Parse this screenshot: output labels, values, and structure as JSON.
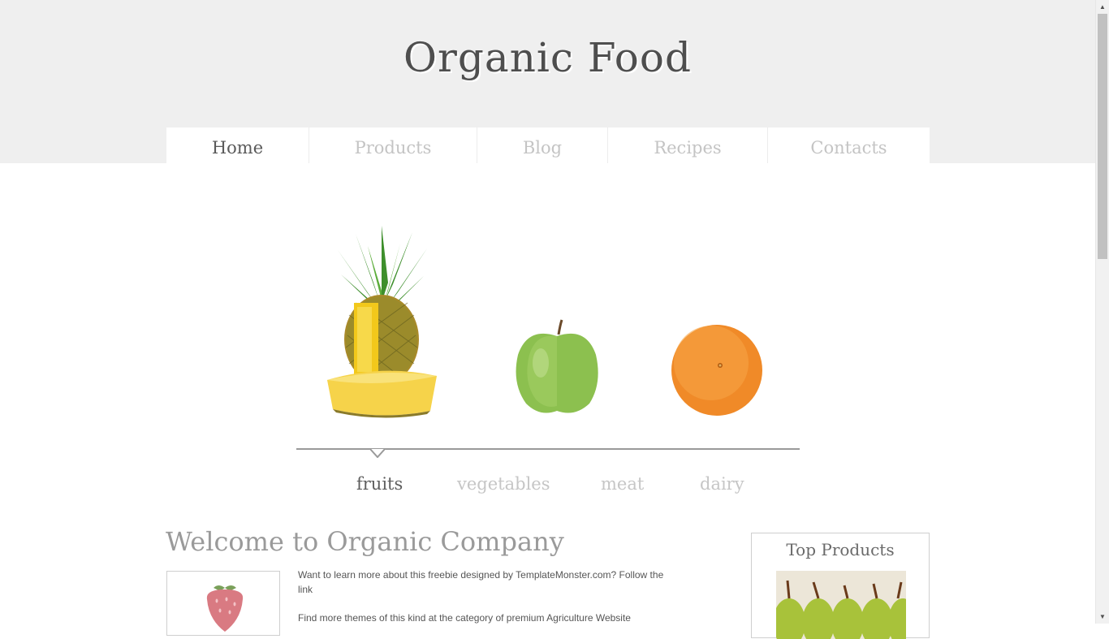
{
  "site": {
    "title": "Organic Food"
  },
  "nav": {
    "items": [
      {
        "label": "Home",
        "active": true
      },
      {
        "label": "Products",
        "active": false
      },
      {
        "label": "Blog",
        "active": false
      },
      {
        "label": "Recipes",
        "active": false
      },
      {
        "label": "Contacts",
        "active": false
      }
    ]
  },
  "slider": {
    "images": [
      "pineapple-image",
      "green-apple-image",
      "orange-image"
    ],
    "categories": [
      {
        "label": "fruits",
        "active": true
      },
      {
        "label": "vegetables",
        "active": false
      },
      {
        "label": "meat",
        "active": false
      },
      {
        "label": "dairy",
        "active": false
      }
    ]
  },
  "welcome": {
    "title": "Welcome to Organic Company",
    "paragraphs": [
      "Want to learn more about this freebie designed by TemplateMonster.com? Follow the link",
      "Find more themes of this kind at the category of premium Agriculture Website"
    ],
    "thumbnail_icon": "strawberry-icon"
  },
  "sidebar": {
    "top_products_title": "Top Products",
    "image_icon": "pears-image"
  },
  "colors": {
    "header_bg": "#efefef",
    "nav_active": "#5a5a5a",
    "nav_inactive": "#c4c4c4",
    "title_text": "#4e4e4e"
  }
}
